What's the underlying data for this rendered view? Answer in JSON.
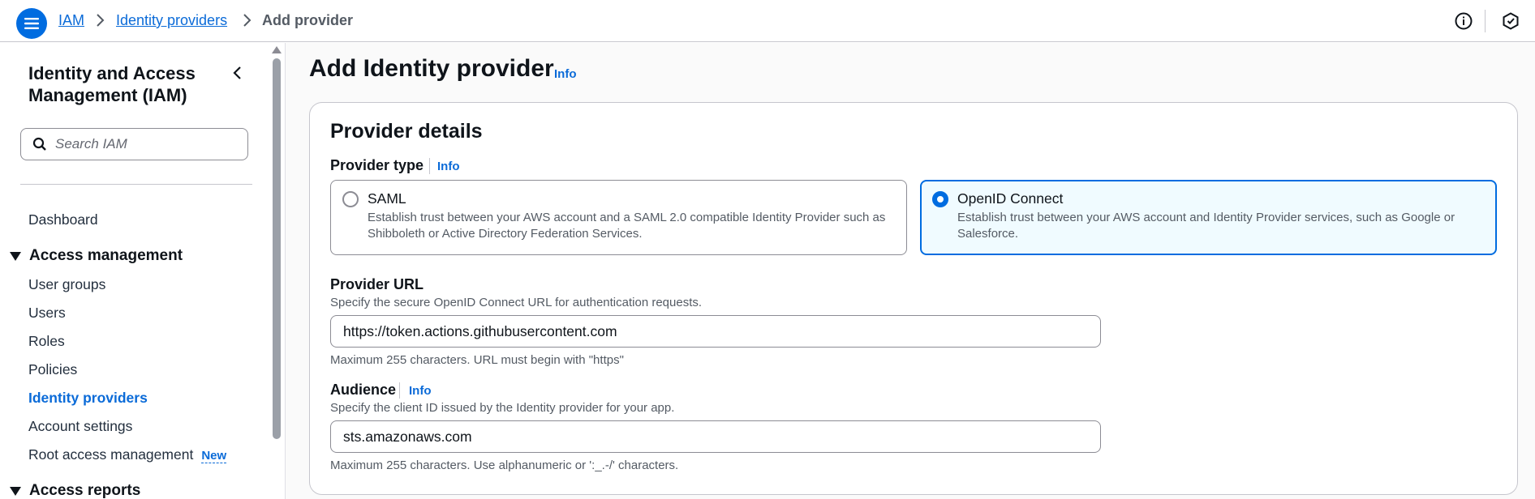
{
  "breadcrumbs": {
    "items": [
      {
        "label": "IAM"
      },
      {
        "label": "Identity providers"
      }
    ],
    "current": "Add provider"
  },
  "sidebar": {
    "title": "Identity and Access Management (IAM)",
    "search_placeholder": "Search IAM",
    "dashboard": "Dashboard",
    "access_management": {
      "label": "Access management",
      "items": [
        {
          "label": "User groups"
        },
        {
          "label": "Users"
        },
        {
          "label": "Roles"
        },
        {
          "label": "Policies"
        },
        {
          "label": "Identity providers",
          "active": true
        },
        {
          "label": "Account settings"
        },
        {
          "label": "Root access management",
          "badge": "New"
        }
      ]
    },
    "access_reports": {
      "label": "Access reports"
    }
  },
  "page": {
    "title": "Add Identity provider",
    "info": "Info"
  },
  "provider_details": {
    "title": "Provider details",
    "provider_type": {
      "label": "Provider type",
      "info": "Info",
      "options": [
        {
          "title": "SAML",
          "description": "Establish trust between your AWS account and a SAML 2.0 compatible Identity Provider such as Shibboleth or Active Directory Federation Services.",
          "selected": false
        },
        {
          "title": "OpenID Connect",
          "description": "Establish trust between your AWS account and Identity Provider services, such as Google or Salesforce.",
          "selected": true
        }
      ]
    },
    "provider_url": {
      "label": "Provider URL",
      "description": "Specify the secure OpenID Connect URL for authentication requests.",
      "value": "https://token.actions.githubusercontent.com",
      "constraint": "Maximum 255 characters. URL must begin with \"https\""
    },
    "audience": {
      "label": "Audience",
      "info": "Info",
      "description": "Specify the client ID issued by the Identity provider for your app.",
      "value": "sts.amazonaws.com",
      "constraint": "Maximum 255 characters. Use alphanumeric or ':_.-/' characters."
    }
  },
  "colors": {
    "accent": "#006ce0",
    "link": "#0b6bd8",
    "selected_tile_bg": "#f0fbff"
  },
  "icons": {
    "menu": "hamburger-menu-icon",
    "breadcrumb_separator": "chevron-right-icon",
    "info": "info-circle-icon",
    "settings": "hexagon-settings-icon",
    "collapse": "chevron-left-icon",
    "search": "search-icon"
  }
}
